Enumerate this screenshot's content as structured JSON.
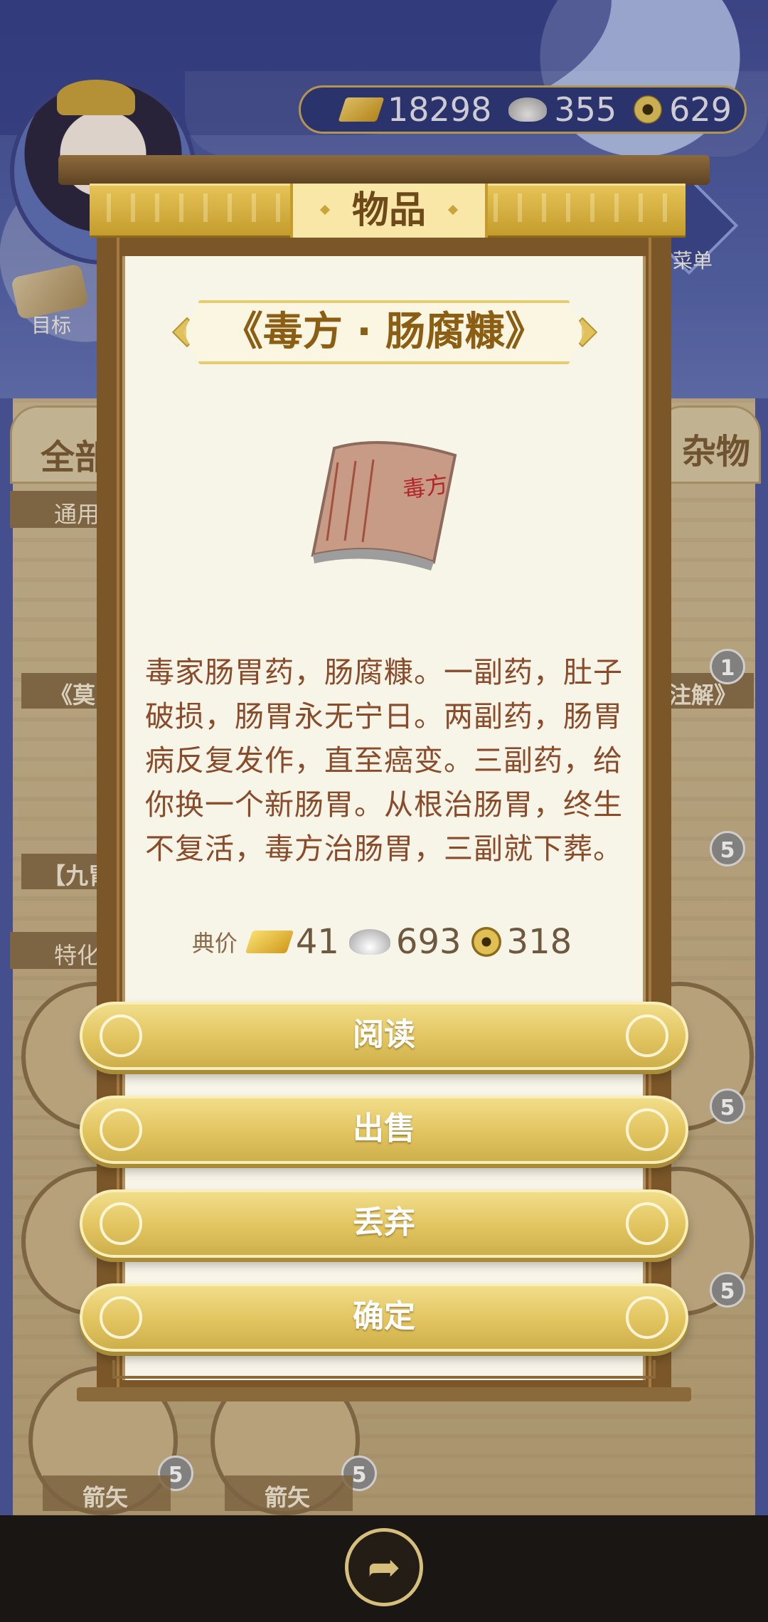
{
  "resources": {
    "gold": "18298",
    "silver": "355",
    "coin": "629"
  },
  "header": {
    "menu_label": "菜单",
    "goal_label": "目标"
  },
  "background": {
    "category_left": "全部",
    "category_right": "杂物",
    "sub_tab_1": "通用",
    "sub_tab_2": "特化",
    "badge_1": "1",
    "badge_5": "5",
    "item_label_arrow": "箭矢",
    "item_label_left1": "《莫",
    "item_label_left2": "【九胃",
    "item_label_right1": "注解》"
  },
  "dialog": {
    "title": "物品",
    "item_name": "《毒方 · 肠腐糠》",
    "item_image_text": "毒方",
    "description": "毒家肠胃药，肠腐糠。一副药，肚子破损，肠胃永无宁日。两副药，肠胃病反复发作，直至癌变。三副药，给你换一个新肠胃。从根治肠胃，终生不复活，毒方治肠胃，三副就下葬。",
    "price_label": "典价",
    "price_gold": "41",
    "price_silver": "693",
    "price_coin": "318",
    "buttons": {
      "read": "阅读",
      "sell": "出售",
      "discard": "丢弃",
      "confirm": "确定"
    }
  },
  "icons": [
    "gold-ingot-icon",
    "silver-ingot-icon",
    "copper-coin-icon",
    "share-icon",
    "recipe-scroll-icon"
  ]
}
